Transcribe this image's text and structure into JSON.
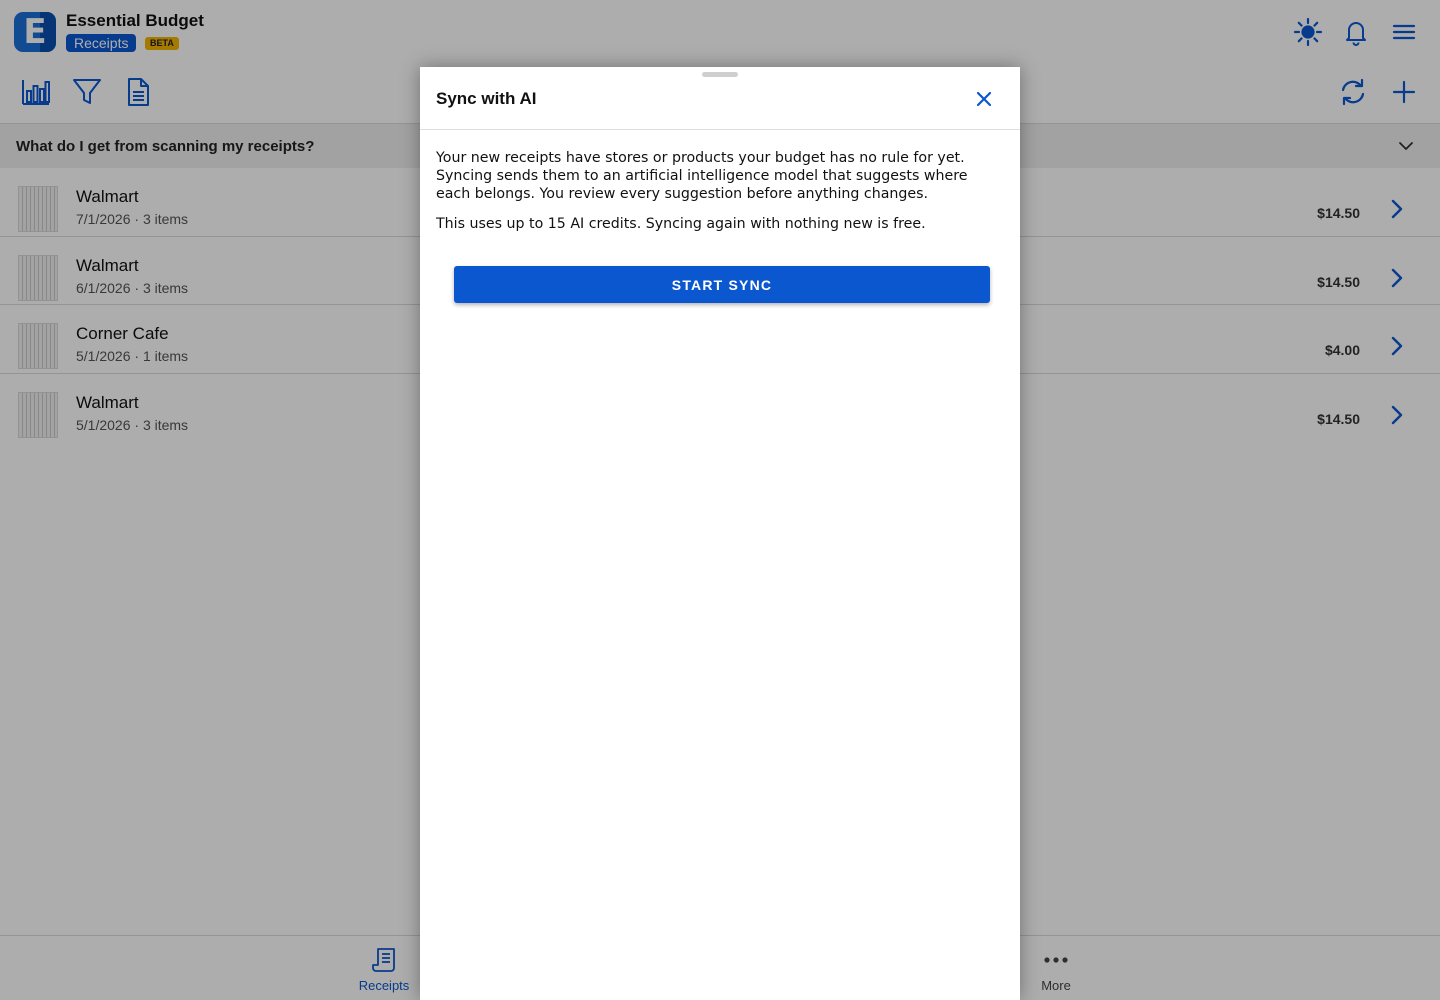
{
  "app": {
    "title": "Essential Budget",
    "section": "Receipts",
    "badge": "BETA",
    "logo_letter": "E"
  },
  "header_icons": [
    "brightness-icon",
    "notification-bell-icon",
    "hamburger-menu-icon"
  ],
  "toolbar_icons": [
    "bar-chart-icon",
    "filter-icon",
    "document-icon",
    "sync-icon",
    "add-icon"
  ],
  "faq": {
    "question": "What do I get from scanning my receipts?"
  },
  "receipts": [
    {
      "store": "Walmart",
      "meta": "7/1/2026 · 3 items",
      "amount": "$14.50"
    },
    {
      "store": "Walmart",
      "meta": "6/1/2026 · 3 items",
      "amount": "$14.50"
    },
    {
      "store": "Corner Cafe",
      "meta": "5/1/2026 · 1 items",
      "amount": "$4.00"
    },
    {
      "store": "Walmart",
      "meta": "5/1/2026 · 3 items",
      "amount": "$14.50"
    }
  ],
  "bottom_nav": {
    "receipts_label": "Receipts",
    "more_label": "More"
  },
  "dialog": {
    "title": "Sync with AI",
    "body_paragraph_1": "Your new receipts have stores or products your budget has no rule for yet. Syncing sends them to an artificial intelligence model that suggests where each belongs. You review every suggestion before anything changes.",
    "body_paragraph_2": "This uses up to 15 AI credits. Syncing again with nothing new is free.",
    "button_label": "START SYNC"
  },
  "colors": {
    "accent": "#0b57d0",
    "badge": "#f4b400",
    "scrim": "rgba(0,0,0,0.32)"
  }
}
